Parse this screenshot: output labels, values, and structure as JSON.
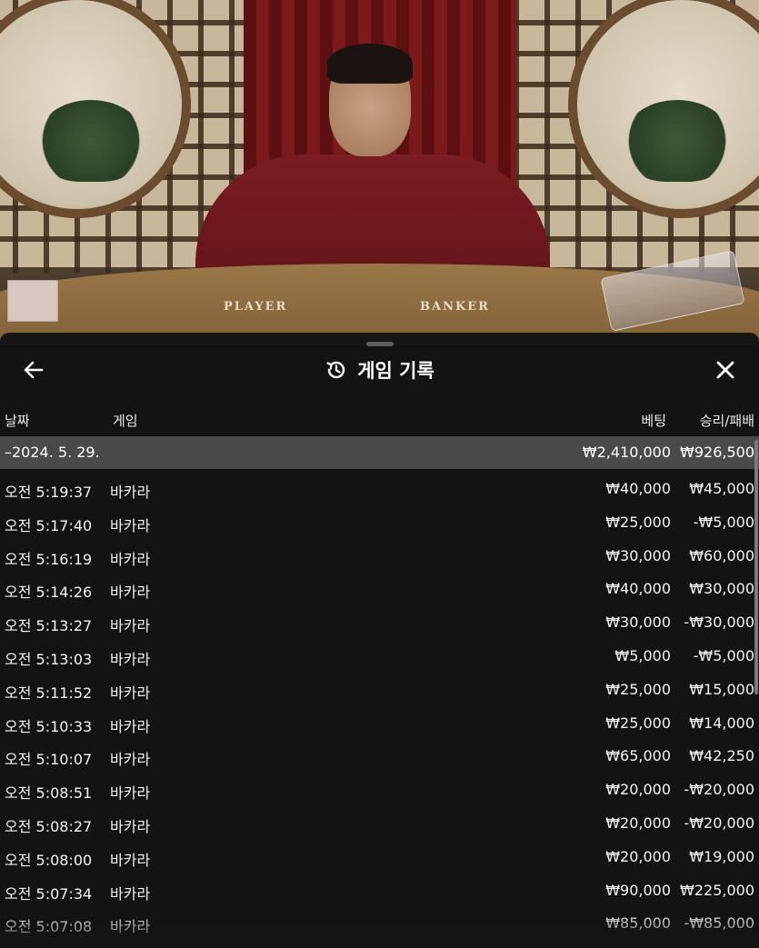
{
  "scene": {
    "table_labels": [
      "PLAYER",
      "BANKER"
    ]
  },
  "panel": {
    "title": "게임 기록",
    "icons": {
      "back": "arrow-left-icon",
      "history": "history-icon",
      "close": "close-icon"
    },
    "columns": {
      "date": "날짜",
      "game": "게임",
      "bet": "베팅",
      "winloss": "승리/패배"
    },
    "summary": {
      "date": "–2024. 5. 29.",
      "bet": "₩2,410,000",
      "winloss": "₩926,500"
    },
    "rows": [
      {
        "time": "오전 5:19:37",
        "game": "바카라",
        "bet": "₩40,000",
        "winloss": "₩45,000"
      },
      {
        "time": "오전 5:17:40",
        "game": "바카라",
        "bet": "₩25,000",
        "winloss": "-₩5,000"
      },
      {
        "time": "오전 5:16:19",
        "game": "바카라",
        "bet": "₩30,000",
        "winloss": "₩60,000"
      },
      {
        "time": "오전 5:14:26",
        "game": "바카라",
        "bet": "₩40,000",
        "winloss": "₩30,000"
      },
      {
        "time": "오전 5:13:27",
        "game": "바카라",
        "bet": "₩30,000",
        "winloss": "-₩30,000"
      },
      {
        "time": "오전 5:13:03",
        "game": "바카라",
        "bet": "₩5,000",
        "winloss": "-₩5,000"
      },
      {
        "time": "오전 5:11:52",
        "game": "바카라",
        "bet": "₩25,000",
        "winloss": "₩15,000"
      },
      {
        "time": "오전 5:10:33",
        "game": "바카라",
        "bet": "₩25,000",
        "winloss": "₩14,000"
      },
      {
        "time": "오전 5:10:07",
        "game": "바카라",
        "bet": "₩65,000",
        "winloss": "₩42,250"
      },
      {
        "time": "오전 5:08:51",
        "game": "바카라",
        "bet": "₩20,000",
        "winloss": "-₩20,000"
      },
      {
        "time": "오전 5:08:27",
        "game": "바카라",
        "bet": "₩20,000",
        "winloss": "-₩20,000"
      },
      {
        "time": "오전 5:08:00",
        "game": "바카라",
        "bet": "₩20,000",
        "winloss": "₩19,000"
      },
      {
        "time": "오전 5:07:34",
        "game": "바카라",
        "bet": "₩90,000",
        "winloss": "₩225,000"
      },
      {
        "time": "오전 5:07:08",
        "game": "바카라",
        "bet": "₩85,000",
        "winloss": "-₩85,000"
      }
    ]
  }
}
